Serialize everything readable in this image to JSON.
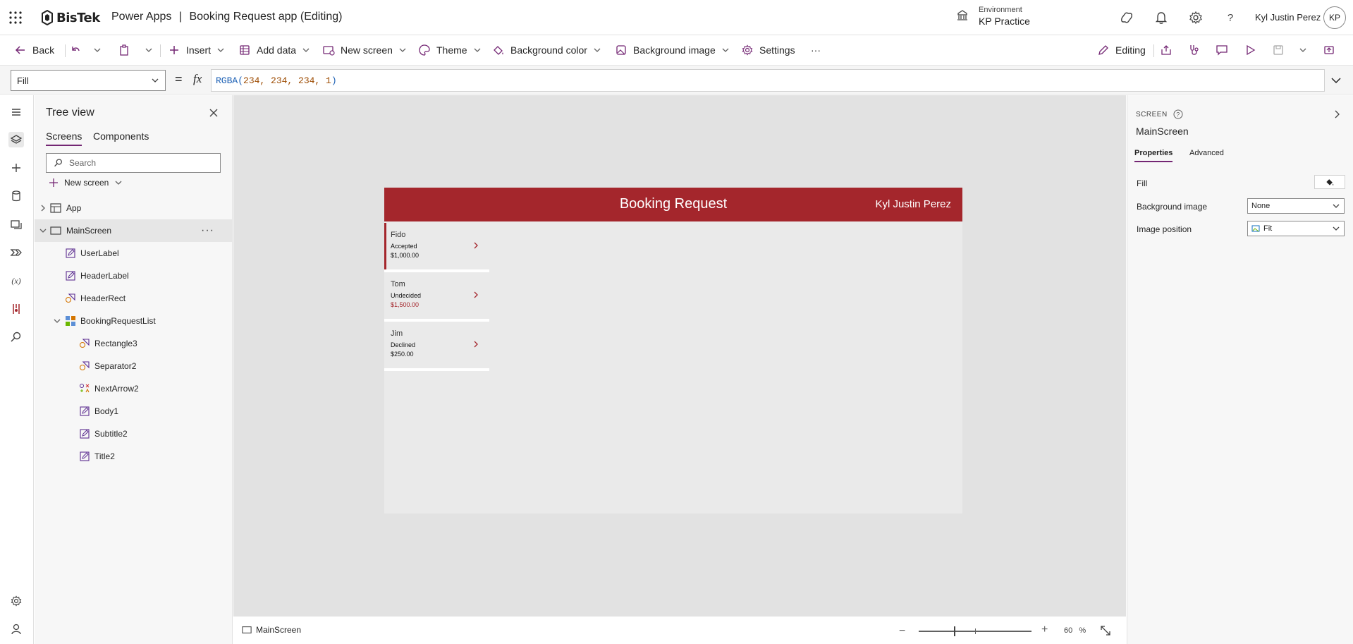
{
  "header": {
    "logo_text": "BisTek",
    "product": "Power Apps",
    "divider": "|",
    "app_title": "Booking Request app (Editing)",
    "environment_label": "Environment",
    "environment_name": "KP Practice",
    "user_name": "Kyl Justin Perez",
    "user_initials": "KP"
  },
  "commandbar": {
    "back": "Back",
    "insert": "Insert",
    "add_data": "Add data",
    "new_screen": "New screen",
    "theme": "Theme",
    "background_color": "Background color",
    "background_image": "Background image",
    "settings": "Settings",
    "more": "···",
    "editing": "Editing"
  },
  "formula_bar": {
    "property": "Fill",
    "equals": "=",
    "fx": "fx",
    "formula_fn": "RGBA(",
    "formula_args": "234, 234, 234, 1",
    "formula_close": ")"
  },
  "tree_view": {
    "title": "Tree view",
    "tabs": [
      "Screens",
      "Components"
    ],
    "search_placeholder": "Search",
    "new_screen": "New screen",
    "nodes": {
      "app": "App",
      "main_screen": "MainScreen",
      "user_label": "UserLabel",
      "header_label": "HeaderLabel",
      "header_rect": "HeaderRect",
      "booking_list": "BookingRequestList",
      "rectangle3": "Rectangle3",
      "separator2": "Separator2",
      "next_arrow2": "NextArrow2",
      "body1": "Body1",
      "subtitle2": "Subtitle2",
      "title2": "Title2"
    },
    "more": "···"
  },
  "canvas_app": {
    "header_title": "Booking Request",
    "header_user": "Kyl Justin Perez",
    "header_color": "#a4262c",
    "background": "#eaeaea",
    "bookings": [
      {
        "name": "Fido",
        "status": "Accepted",
        "amount": "$1,000.00"
      },
      {
        "name": "Tom",
        "status": "Undecided",
        "amount": "$1,500.00"
      },
      {
        "name": "Jim",
        "status": "Declined",
        "amount": "$250.00"
      }
    ]
  },
  "status_bar": {
    "screen": "MainScreen",
    "zoom_minus": "−",
    "zoom_plus": "+",
    "zoom_value": "60",
    "zoom_unit": "%"
  },
  "properties": {
    "kind": "SCREEN",
    "name": "MainScreen",
    "tabs": [
      "Properties",
      "Advanced"
    ],
    "fill_label": "Fill",
    "bg_image_label": "Background image",
    "bg_image_value": "None",
    "img_position_label": "Image position",
    "img_position_value": "Fit"
  },
  "colors": {
    "accent": "#742774",
    "brand_red": "#a4262c"
  }
}
